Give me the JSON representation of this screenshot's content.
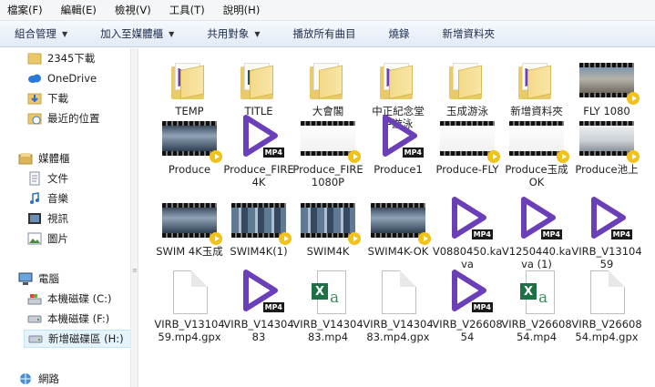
{
  "menu": [
    "檔案(F)",
    "編輯(E)",
    "檢視(V)",
    "工具(T)",
    "說明(H)"
  ],
  "toolbar": [
    {
      "label": "組合管理",
      "dropdown": true
    },
    {
      "label": "加入至媒體櫃",
      "dropdown": true
    },
    {
      "label": "共用對象",
      "dropdown": true
    },
    {
      "label": "播放所有曲目",
      "dropdown": false
    },
    {
      "label": "燒錄",
      "dropdown": false
    },
    {
      "label": "新增資料夾",
      "dropdown": false
    }
  ],
  "nav": [
    {
      "label": "2345下載",
      "icon": "folder-icon",
      "type": "folder"
    },
    {
      "label": "OneDrive",
      "icon": "onedrive-icon",
      "type": "cloud"
    },
    {
      "label": "下載",
      "icon": "downloads-icon",
      "type": "down"
    },
    {
      "label": "最近的位置",
      "icon": "recent-places-icon",
      "type": "recent"
    },
    {
      "label": "媒體櫃",
      "icon": "libraries-icon",
      "type": "lib"
    },
    {
      "label": "文件",
      "icon": "documents-icon",
      "type": "docs"
    },
    {
      "label": "音樂",
      "icon": "music-icon",
      "type": "music"
    },
    {
      "label": "視訊",
      "icon": "videos-icon",
      "type": "video"
    },
    {
      "label": "圖片",
      "icon": "pictures-icon",
      "type": "pics"
    },
    {
      "label": "電腦",
      "icon": "computer-icon",
      "type": "pc"
    },
    {
      "label": "本機磁碟 (C:)",
      "icon": "windows-drive-icon",
      "type": "cdrive"
    },
    {
      "label": "本機磁碟 (F:)",
      "icon": "drive-icon",
      "type": "drive"
    },
    {
      "label": "新增磁碟區 (H:)",
      "icon": "drive-icon",
      "type": "drive",
      "selected": true
    },
    {
      "label": "網路",
      "icon": "network-icon",
      "type": "net"
    }
  ],
  "files": [
    {
      "name": "TEMP",
      "kind": "folder",
      "overlay": "mp4"
    },
    {
      "name": "TITLE",
      "kind": "folder",
      "overlay": "photo"
    },
    {
      "name": "大會閣",
      "kind": "folder",
      "overlay": "none"
    },
    {
      "name": "中正紀念堂+游泳",
      "kind": "folder",
      "overlay": "mp4"
    },
    {
      "name": "玉成游泳",
      "kind": "folder",
      "overlay": "none"
    },
    {
      "name": "新增資料夾",
      "kind": "folder",
      "overlay": "mp4"
    },
    {
      "name": "FLY 1080",
      "kind": "video",
      "scene": "city"
    },
    {
      "name": "Produce",
      "kind": "video",
      "scene": "pool"
    },
    {
      "name": "Produce_FIRE 4K",
      "kind": "mp4"
    },
    {
      "name": "Produce_FIRE 1080P",
      "kind": "video",
      "scene": "white"
    },
    {
      "name": "Produce1",
      "kind": "mp4"
    },
    {
      "name": "Produce-FLY",
      "kind": "video",
      "scene": "white"
    },
    {
      "name": "Produce玉成OK",
      "kind": "video",
      "scene": "white"
    },
    {
      "name": "Produce池上",
      "kind": "video",
      "scene": "road"
    },
    {
      "name": "SWIM 4K玉成",
      "kind": "video",
      "scene": "pool"
    },
    {
      "name": "SWIM4K(1)",
      "kind": "video",
      "scene": "lanes"
    },
    {
      "name": "SWIM4K",
      "kind": "video",
      "scene": "lanes"
    },
    {
      "name": "SWIM4K-OK",
      "kind": "video",
      "scene": "pool"
    },
    {
      "name": "V0880450.kava",
      "kind": "mp4"
    },
    {
      "name": "V1250440.kava (1)",
      "kind": "mp4"
    },
    {
      "name": "VIRB_V1310459",
      "kind": "mp4"
    },
    {
      "name": "VIRB_V1310459.mp4.gpx",
      "kind": "doc"
    },
    {
      "name": "VIRB_V1430483",
      "kind": "mp4"
    },
    {
      "name": "VIRB_V1430483.mp4",
      "kind": "xls"
    },
    {
      "name": "VIRB_V1430483.mp4.gpx",
      "kind": "doc"
    },
    {
      "name": "VIRB_V2660854",
      "kind": "mp4"
    },
    {
      "name": "VIRB_V2660854.mp4",
      "kind": "xls"
    },
    {
      "name": "VIRB_V2660854.mp4.gpx",
      "kind": "doc"
    }
  ],
  "colors": {
    "mp4_play": "#6b3fb8",
    "selection": "#e5f3fb",
    "toolbar_text": "#1b2b48"
  }
}
